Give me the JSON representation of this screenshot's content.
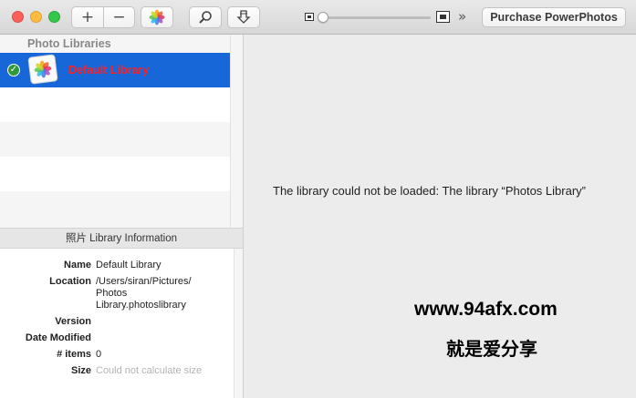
{
  "toolbar": {
    "add_label": "+",
    "remove_label": "−",
    "overflow_label": "»",
    "purchase_label": "Purchase PowerPhotos",
    "zoom_level": 0.02
  },
  "sidebar": {
    "libraries_header": "Photo Libraries",
    "libraries": [
      {
        "name": "Default Library",
        "selected": true,
        "checked": true
      }
    ],
    "info_header": "照片 Library Information",
    "info": {
      "name_label": "Name",
      "name_value": "Default Library",
      "location_label": "Location",
      "location_line1": "/Users/siran/Pictures/",
      "location_line2": "Photos",
      "location_line3": "Library.photoslibrary",
      "version_label": "Version",
      "version_value": "",
      "date_label": "Date Modified",
      "date_value": "",
      "items_label": "# items",
      "items_value": "0",
      "size_label": "Size",
      "size_value": "Could not calculate size"
    }
  },
  "main": {
    "error_message": "The library could not be loaded: The library “Photos Library”",
    "watermark_url": "www.94afx.com",
    "watermark_text": "就是爱分享"
  },
  "colors": {
    "selection": "#1767d9",
    "library_name": "#ff2020",
    "check_green": "#2e9a3a"
  },
  "icons": [
    "photos-app-icon",
    "search-icon",
    "download-icon",
    "small-thumbnail-icon",
    "large-thumbnail-icon",
    "checkmark-icon"
  ]
}
